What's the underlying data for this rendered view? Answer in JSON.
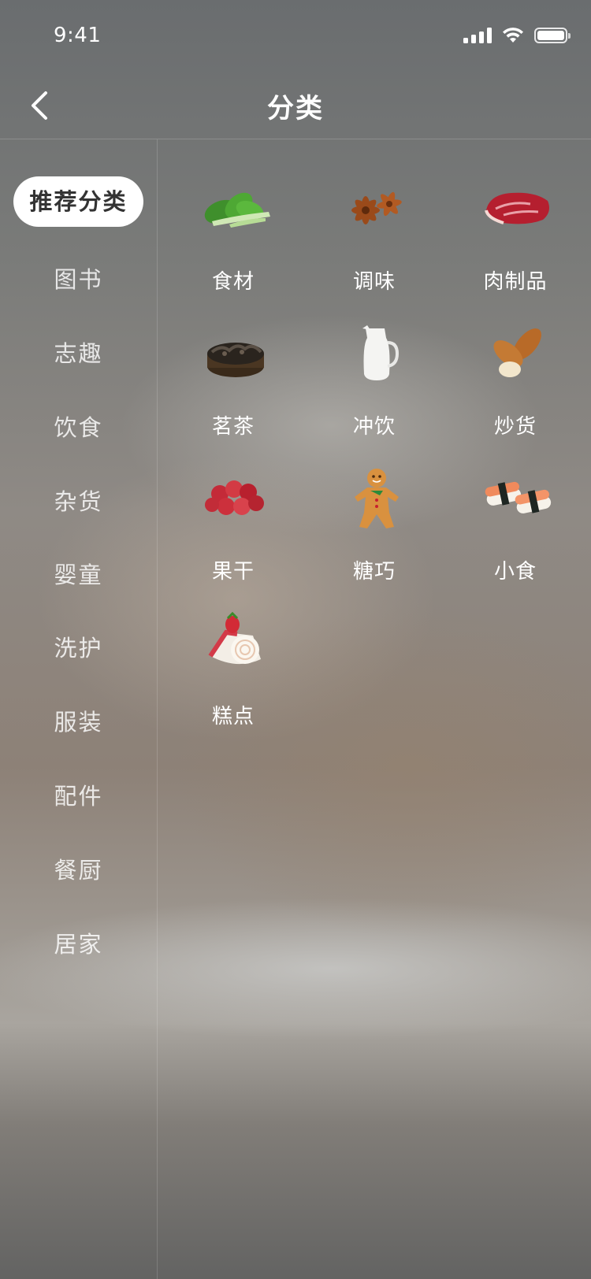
{
  "status": {
    "time": "9:41"
  },
  "nav": {
    "title": "分类"
  },
  "sidebar": {
    "items": [
      {
        "label": "推荐分类",
        "active": true
      },
      {
        "label": "图书"
      },
      {
        "label": "志趣"
      },
      {
        "label": "饮食"
      },
      {
        "label": "杂货"
      },
      {
        "label": "婴童"
      },
      {
        "label": "洗护"
      },
      {
        "label": "服装"
      },
      {
        "label": "配件"
      },
      {
        "label": "餐厨"
      },
      {
        "label": "居家"
      }
    ]
  },
  "categories": [
    {
      "label": "食材",
      "icon": "bok-choy-icon"
    },
    {
      "label": "调味",
      "icon": "star-anise-icon"
    },
    {
      "label": "肉制品",
      "icon": "steak-icon"
    },
    {
      "label": "茗茶",
      "icon": "tea-leaves-icon"
    },
    {
      "label": "冲饮",
      "icon": "milk-jug-icon"
    },
    {
      "label": "炒货",
      "icon": "almonds-icon"
    },
    {
      "label": "果干",
      "icon": "dried-dates-icon"
    },
    {
      "label": "糖巧",
      "icon": "gingerbread-man-icon"
    },
    {
      "label": "小食",
      "icon": "sushi-icon"
    },
    {
      "label": "糕点",
      "icon": "swiss-roll-icon"
    }
  ]
}
